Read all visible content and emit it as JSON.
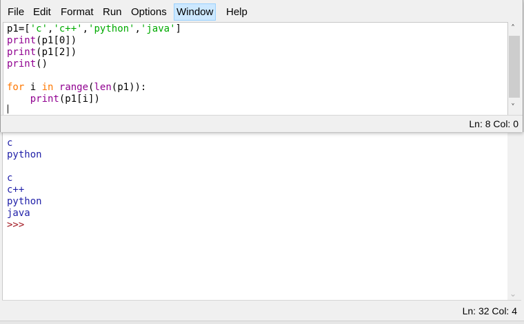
{
  "editor": {
    "menu": [
      "File",
      "Edit",
      "Format",
      "Run",
      "Options",
      "Window",
      "Help"
    ],
    "active_menu": "Window",
    "code": [
      [
        {
          "t": "p1=[",
          "c": "plain"
        },
        {
          "t": "'c'",
          "c": "str"
        },
        {
          "t": ",",
          "c": "plain"
        },
        {
          "t": "'c++'",
          "c": "str"
        },
        {
          "t": ",",
          "c": "plain"
        },
        {
          "t": "'python'",
          "c": "str"
        },
        {
          "t": ",",
          "c": "plain"
        },
        {
          "t": "'java'",
          "c": "str"
        },
        {
          "t": "]",
          "c": "plain"
        }
      ],
      [
        {
          "t": "print",
          "c": "bi"
        },
        {
          "t": "(p1[0])",
          "c": "plain"
        }
      ],
      [
        {
          "t": "print",
          "c": "bi"
        },
        {
          "t": "(p1[2])",
          "c": "plain"
        }
      ],
      [
        {
          "t": "print",
          "c": "bi"
        },
        {
          "t": "()",
          "c": "plain"
        }
      ],
      [],
      [
        {
          "t": "for",
          "c": "kw"
        },
        {
          "t": " i ",
          "c": "plain"
        },
        {
          "t": "in",
          "c": "kw"
        },
        {
          "t": " ",
          "c": "plain"
        },
        {
          "t": "range",
          "c": "bi"
        },
        {
          "t": "(",
          "c": "plain"
        },
        {
          "t": "len",
          "c": "bi"
        },
        {
          "t": "(p1)):",
          "c": "plain"
        }
      ],
      [
        {
          "t": "    ",
          "c": "plain"
        },
        {
          "t": "print",
          "c": "bi"
        },
        {
          "t": "(p1[i])",
          "c": "plain"
        }
      ]
    ],
    "status": "Ln: 8   Col: 0"
  },
  "shell": {
    "lines": [
      {
        "t": "c",
        "c": "out"
      },
      {
        "t": "python",
        "c": "out"
      },
      {
        "t": "",
        "c": "out"
      },
      {
        "t": "c",
        "c": "out"
      },
      {
        "t": "c++",
        "c": "out"
      },
      {
        "t": "python",
        "c": "out"
      },
      {
        "t": "java",
        "c": "out"
      },
      {
        "t": ">>>",
        "c": "prompt"
      }
    ],
    "status": "Ln: 32   Col: 4"
  },
  "colors": {
    "keyword": "#ff7700",
    "string": "#00aa00",
    "builtin": "#900090",
    "output": "#1f1fa8",
    "prompt": "#a0141e",
    "menu_highlight": "#cce8ff"
  }
}
